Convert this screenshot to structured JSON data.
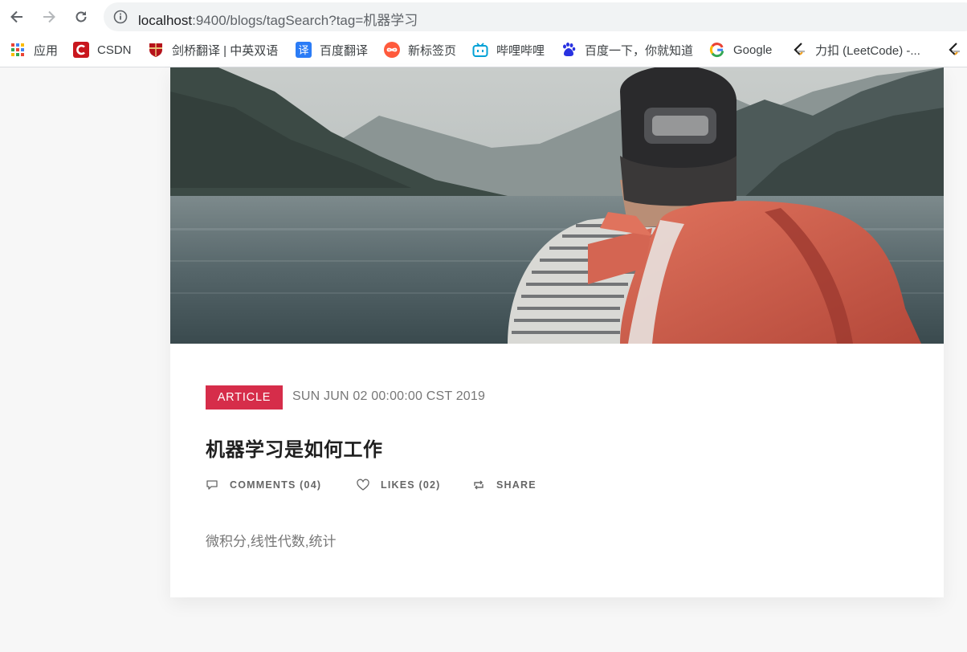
{
  "browser": {
    "url_host": "localhost",
    "url_rest": ":9400/blogs/tagSearch?tag=机器学习"
  },
  "bookmarks": [
    {
      "label": "应用",
      "icon": "apps-grid-icon"
    },
    {
      "label": "CSDN",
      "icon": "csdn-icon"
    },
    {
      "label": "剑桥翻译 | 中英双语",
      "icon": "cambridge-shield-icon"
    },
    {
      "label": "百度翻译",
      "icon": "baidu-translate-icon"
    },
    {
      "label": "新标签页",
      "icon": "infinity-icon"
    },
    {
      "label": "哔哩哔哩",
      "icon": "bilibili-icon"
    },
    {
      "label": "百度一下，你就知道",
      "icon": "baidu-paw-icon"
    },
    {
      "label": "Google",
      "icon": "google-g-icon"
    },
    {
      "label": "力扣 (LeetCode) -...",
      "icon": "leetcode-icon"
    }
  ],
  "post": {
    "category": "ARTICLE",
    "date": "SUN JUN 02 00:00:00 CST 2019",
    "title": "机器学习是如何工作",
    "comments": "COMMENTS (04)",
    "likes": "LIKES (02)",
    "share": "SHARE",
    "excerpt": "微积分,线性代数,统计"
  },
  "colors": {
    "badge": "#d62d4a",
    "page_bg": "#f7f7f7"
  }
}
